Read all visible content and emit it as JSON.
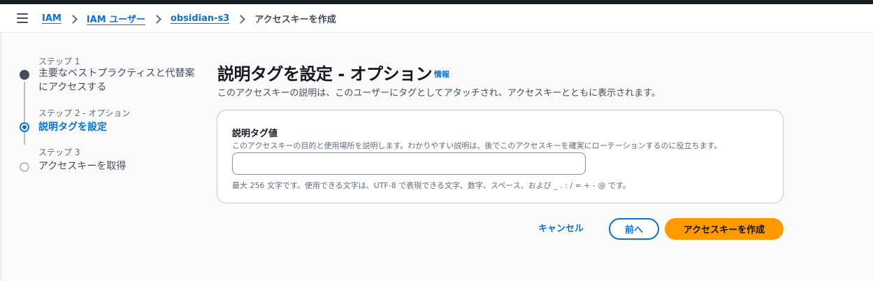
{
  "breadcrumb": {
    "items": [
      "IAM",
      "IAM ユーザー",
      "obsidian-s3"
    ],
    "current": "アクセスキーを作成"
  },
  "steps": [
    {
      "caption": "ステップ 1",
      "title": "主要なベストプラクティスと代替案にアクセスする",
      "state": "done"
    },
    {
      "caption": "ステップ 2 - オプション",
      "title": "説明タグを設定",
      "state": "active"
    },
    {
      "caption": "ステップ 3",
      "title": "アクセスキーを取得",
      "state": "upcoming"
    }
  ],
  "main": {
    "title": "説明タグを設定 - オプション",
    "info_link": "情報",
    "description": "このアクセスキーの説明は、このユーザーにタグとしてアタッチされ、アクセスキーとともに表示されます。"
  },
  "field": {
    "label": "説明タグ値",
    "description": "このアクセスキーの目的と使用場所を説明します。わかりやすい説明は、後でこのアクセスキーを確実にローテーションするのに役立ちます。",
    "value": "",
    "constraint": "最大 256 文字です。使用できる文字は、UTF-8 で表現できる文字、数字、スペース、および _ . : / = + - @ です。"
  },
  "actions": {
    "cancel": "キャンセル",
    "previous": "前へ",
    "create": "アクセスキーを作成"
  },
  "colors": {
    "link": "#0972d3",
    "primary_button": "#ff9900",
    "top_bar": "#161d26"
  }
}
